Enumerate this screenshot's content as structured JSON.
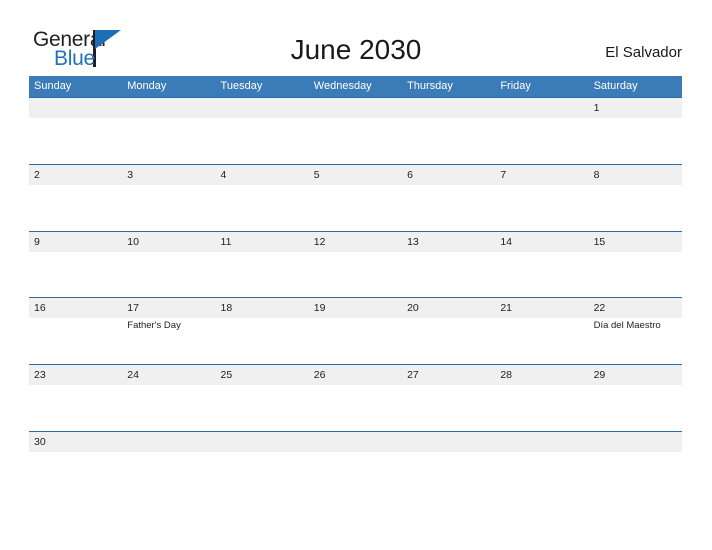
{
  "brand": {
    "word_one": "General",
    "word_two": "Blue",
    "triangle_icon": "triangle-icon",
    "accent_color": "#2272b6"
  },
  "header": {
    "title": "June 2030",
    "country": "El Salvador"
  },
  "calendar": {
    "header_color": "#3b7cb8",
    "row_line_color": "#2e6da4",
    "band_color": "#f0f0f0",
    "weekdays": [
      "Sunday",
      "Monday",
      "Tuesday",
      "Wednesday",
      "Thursday",
      "Friday",
      "Saturday"
    ],
    "weeks": [
      [
        {
          "day": "",
          "event": ""
        },
        {
          "day": "",
          "event": ""
        },
        {
          "day": "",
          "event": ""
        },
        {
          "day": "",
          "event": ""
        },
        {
          "day": "",
          "event": ""
        },
        {
          "day": "",
          "event": ""
        },
        {
          "day": "1",
          "event": ""
        }
      ],
      [
        {
          "day": "2",
          "event": ""
        },
        {
          "day": "3",
          "event": ""
        },
        {
          "day": "4",
          "event": ""
        },
        {
          "day": "5",
          "event": ""
        },
        {
          "day": "6",
          "event": ""
        },
        {
          "day": "7",
          "event": ""
        },
        {
          "day": "8",
          "event": ""
        }
      ],
      [
        {
          "day": "9",
          "event": ""
        },
        {
          "day": "10",
          "event": ""
        },
        {
          "day": "11",
          "event": ""
        },
        {
          "day": "12",
          "event": ""
        },
        {
          "day": "13",
          "event": ""
        },
        {
          "day": "14",
          "event": ""
        },
        {
          "day": "15",
          "event": ""
        }
      ],
      [
        {
          "day": "16",
          "event": ""
        },
        {
          "day": "17",
          "event": "Father's Day"
        },
        {
          "day": "18",
          "event": ""
        },
        {
          "day": "19",
          "event": ""
        },
        {
          "day": "20",
          "event": ""
        },
        {
          "day": "21",
          "event": ""
        },
        {
          "day": "22",
          "event": "Día del Maestro"
        }
      ],
      [
        {
          "day": "23",
          "event": ""
        },
        {
          "day": "24",
          "event": ""
        },
        {
          "day": "25",
          "event": ""
        },
        {
          "day": "26",
          "event": ""
        },
        {
          "day": "27",
          "event": ""
        },
        {
          "day": "28",
          "event": ""
        },
        {
          "day": "29",
          "event": ""
        }
      ],
      [
        {
          "day": "30",
          "event": ""
        },
        {
          "day": "",
          "event": ""
        },
        {
          "day": "",
          "event": ""
        },
        {
          "day": "",
          "event": ""
        },
        {
          "day": "",
          "event": ""
        },
        {
          "day": "",
          "event": ""
        },
        {
          "day": "",
          "event": ""
        }
      ]
    ]
  }
}
